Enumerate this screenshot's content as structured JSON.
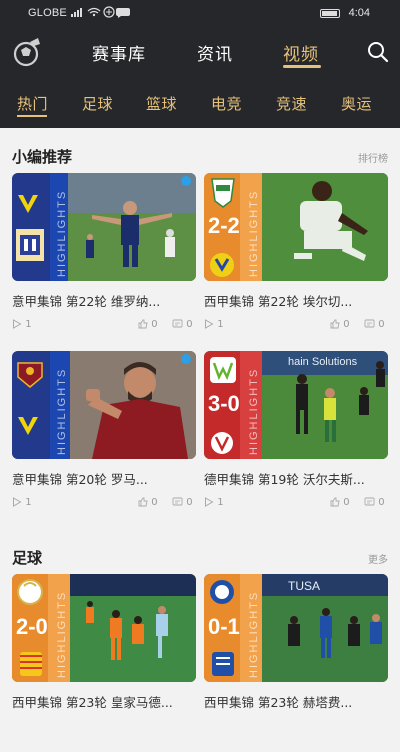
{
  "status_bar": {
    "carrier": "GLOBE",
    "time": "4:04"
  },
  "nav": {
    "tabs": [
      {
        "label": "赛事库"
      },
      {
        "label": "资讯"
      },
      {
        "label": "视频"
      }
    ],
    "active": "视频"
  },
  "categories": [
    {
      "label": "热门"
    },
    {
      "label": "足球"
    },
    {
      "label": "篮球"
    },
    {
      "label": "电竞"
    },
    {
      "label": "竞速"
    },
    {
      "label": "奥运"
    }
  ],
  "sections": [
    {
      "title": "小编推荐",
      "more": "排行榜",
      "cards": [
        {
          "title": "意甲集锦 第22轮 维罗纳...",
          "plays": "1",
          "likes": "0",
          "comments": "0",
          "score": ""
        },
        {
          "title": "西甲集锦 第22轮 埃尔切...",
          "plays": "1",
          "likes": "0",
          "comments": "0",
          "score": "2-2"
        },
        {
          "title": "意甲集锦 第20轮 罗马...",
          "plays": "1",
          "likes": "0",
          "comments": "0",
          "score": ""
        },
        {
          "title": "德甲集锦 第19轮 沃尔夫斯...",
          "plays": "1",
          "likes": "0",
          "comments": "0",
          "score": "3-0"
        }
      ]
    },
    {
      "title": "足球",
      "more": "更多",
      "cards": [
        {
          "title": "西甲集锦 第23轮 皇家马德...",
          "score": "2-0"
        },
        {
          "title": "西甲集锦 第23轮 赫塔费...",
          "score": "0-1"
        }
      ]
    }
  ],
  "thumb_labels": {
    "highlights": "HIGHLIGHTS",
    "ad": "hain Solutions",
    "ad2": "TUSA"
  },
  "colors": {
    "accent": "#e6c17a",
    "header_bg": "#25272b",
    "page_bg": "#f2f2f2"
  }
}
